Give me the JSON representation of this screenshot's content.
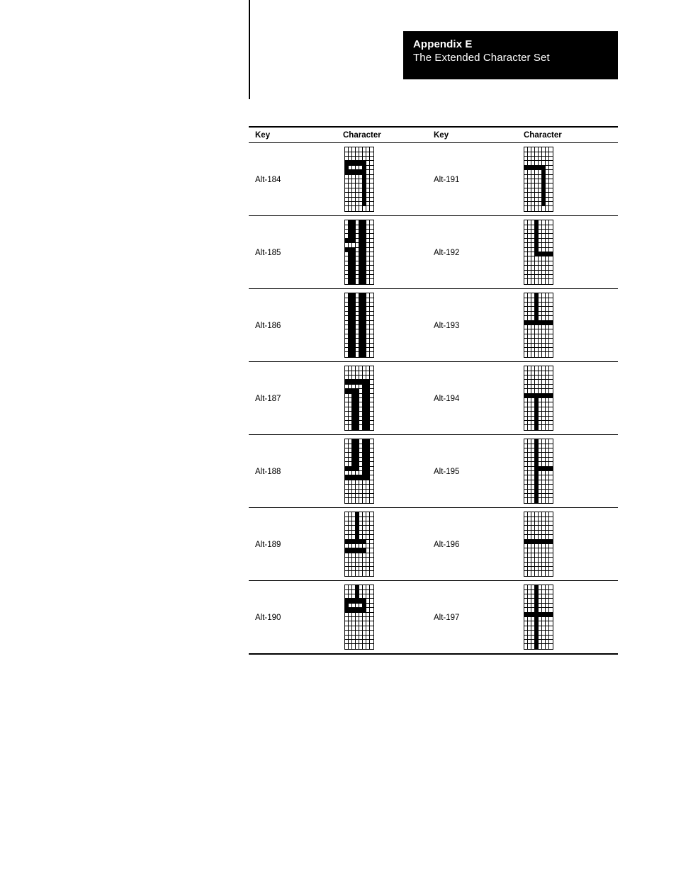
{
  "banner": {
    "title": "Appendix E",
    "subtitle": "The Extended Character Set"
  },
  "table": {
    "headers": {
      "key1": "Key",
      "character1": "Character",
      "key2": "Key",
      "character2": "Character"
    },
    "rows": [
      {
        "key1": "Alt-184",
        "glyph1_name": "box-drawing-down-double-left-single",
        "glyph1": [
          0,
          0,
          0,
          252,
          132,
          252,
          4,
          4,
          4,
          4,
          4,
          4,
          4,
          0
        ],
        "key2": "Alt-191",
        "glyph2_name": "box-drawing-down-left-single",
        "glyph2": [
          0,
          0,
          0,
          0,
          252,
          4,
          4,
          4,
          4,
          4,
          4,
          4,
          4,
          0
        ],
        "glyph2_rows": 14
      },
      {
        "key1": "Alt-185",
        "glyph1_name": "box-drawing-vertical-double-left-double",
        "glyph1": [
          108,
          108,
          108,
          108,
          236,
          12,
          236,
          108,
          108,
          108,
          108,
          108,
          108,
          108
        ],
        "key2": "Alt-192",
        "glyph2_name": "box-drawing-up-right-single",
        "glyph2": [
          16,
          16,
          16,
          16,
          16,
          16,
          16,
          31,
          0,
          0,
          0,
          0,
          0,
          0
        ],
        "glyph2_rows": 14
      },
      {
        "key1": "Alt-186",
        "glyph1_name": "box-drawing-vertical-double",
        "glyph1": [
          108,
          108,
          108,
          108,
          108,
          108,
          108,
          108,
          108,
          108,
          108,
          108,
          108,
          108
        ],
        "key2": "Alt-193",
        "glyph2_name": "box-drawing-up-horizontal-single",
        "glyph2": [
          16,
          16,
          16,
          16,
          16,
          16,
          255,
          0,
          0,
          0,
          0,
          0,
          0,
          0
        ],
        "glyph2_rows": 14
      },
      {
        "key1": "Alt-187",
        "glyph1_name": "box-drawing-down-left-double",
        "glyph1": [
          0,
          0,
          0,
          254,
          6,
          246,
          54,
          54,
          54,
          54,
          54,
          54,
          54,
          54
        ],
        "key2": "Alt-194",
        "glyph2_name": "box-drawing-down-horizontal-single",
        "glyph2": [
          0,
          0,
          0,
          0,
          0,
          0,
          255,
          16,
          16,
          16,
          16,
          16,
          16,
          16
        ],
        "glyph2_rows": 14
      },
      {
        "key1": "Alt-188",
        "glyph1_name": "box-drawing-up-left-double",
        "glyph1": [
          54,
          54,
          54,
          54,
          54,
          54,
          246,
          6,
          254,
          0,
          0,
          0,
          0,
          0
        ],
        "key2": "Alt-195",
        "glyph2_name": "box-drawing-vertical-right-single",
        "glyph2": [
          16,
          16,
          16,
          16,
          16,
          16,
          31,
          16,
          16,
          16,
          16,
          16,
          16,
          16
        ],
        "glyph2_rows": 14
      },
      {
        "key1": "Alt-189",
        "glyph1_name": "box-drawing-up-single-left-double",
        "glyph1": [
          16,
          16,
          16,
          16,
          16,
          16,
          252,
          0,
          252,
          0,
          0,
          0,
          0,
          0
        ],
        "key2": "Alt-196",
        "glyph2_name": "box-drawing-horizontal-single",
        "glyph2": [
          0,
          0,
          0,
          0,
          0,
          0,
          255,
          0,
          0,
          0,
          0,
          0,
          0,
          0
        ],
        "glyph2_rows": 14
      },
      {
        "key1": "Alt-190",
        "glyph1_name": "box-drawing-up-double-left-single",
        "glyph1": [
          16,
          16,
          16,
          252,
          132,
          252,
          0,
          0,
          0,
          0,
          0,
          0,
          0,
          0
        ],
        "key2": "Alt-197",
        "glyph2_name": "box-drawing-cross-single",
        "glyph2": [
          16,
          16,
          16,
          16,
          16,
          16,
          255,
          16,
          16,
          16,
          16,
          16,
          16,
          16
        ],
        "glyph2_rows": 14
      }
    ]
  },
  "glyph_grid": {
    "columns": 8,
    "rows": 14
  }
}
